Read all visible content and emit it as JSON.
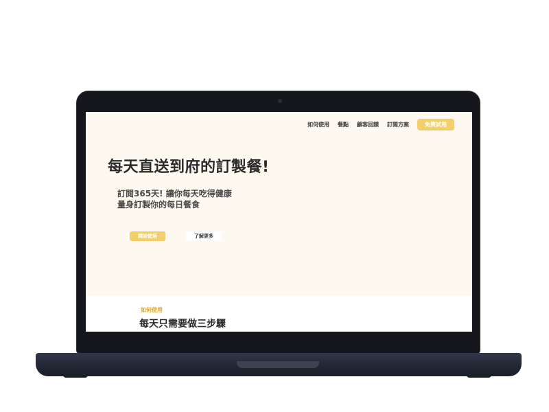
{
  "nav": {
    "items": [
      "如何使用",
      "餐點",
      "顧客回饋",
      "訂閱方案"
    ],
    "cta_label": "免費試用"
  },
  "hero": {
    "title": "每天直送到府的訂製餐!",
    "subtitle_line1": "訂閱365天! 讓你每天吃得健康",
    "subtitle_line2": "量身訂製你的每日餐食",
    "primary_button": "開始使用",
    "secondary_button": "了解更多"
  },
  "section": {
    "eyebrow": "如何使用",
    "title": "每天只需要做三步驟"
  },
  "colors": {
    "accent": "#f2cf6b",
    "background": "#fdf8f0",
    "frame": "#15171c"
  }
}
